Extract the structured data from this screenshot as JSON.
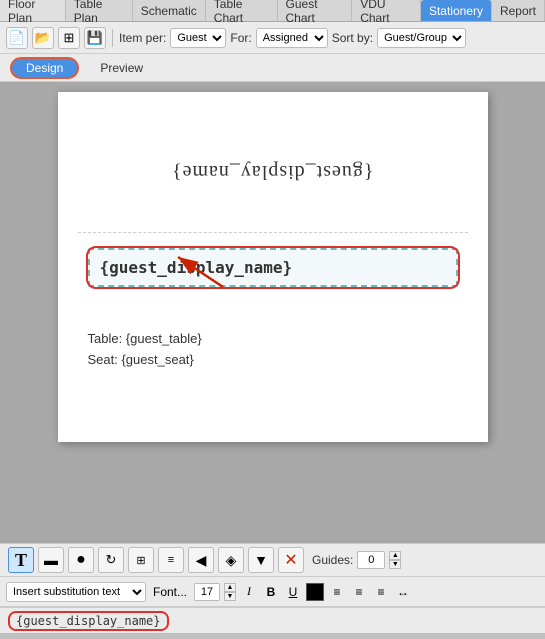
{
  "nav": {
    "tabs": [
      {
        "label": "Floor Plan",
        "active": false
      },
      {
        "label": "Table Plan",
        "active": false
      },
      {
        "label": "Schematic",
        "active": false
      },
      {
        "label": "Table Chart",
        "active": false
      },
      {
        "label": "Guest Chart",
        "active": false
      },
      {
        "label": "VDU Chart",
        "active": false
      },
      {
        "label": "Stationery",
        "active": true
      },
      {
        "label": "Report",
        "active": false
      }
    ]
  },
  "toolbar": {
    "item_per_label": "Item per:",
    "item_per_value": "Guest",
    "for_label": "For:",
    "for_value": "Assigned",
    "sort_by_label": "Sort by:",
    "sort_by_value": "Guest/Group"
  },
  "view_tabs": {
    "design_label": "Design",
    "preview_label": "Preview"
  },
  "canvas": {
    "upside_down_text": "{guest_display_name}",
    "selected_box_text": "{guest_display_name}",
    "other_lines": [
      "Table: {guest_table}",
      "Seat: {guest_seat}"
    ]
  },
  "icon_toolbar": {
    "guides_label": "Guides:",
    "guides_value": "0"
  },
  "text_toolbar": {
    "insert_label": "Insert substitution text",
    "font_label": "Font...",
    "size_value": "17",
    "bold_label": "B",
    "italic_label": "I",
    "underline_label": "U"
  },
  "sub_bar": {
    "text": "{guest_display_name}"
  }
}
